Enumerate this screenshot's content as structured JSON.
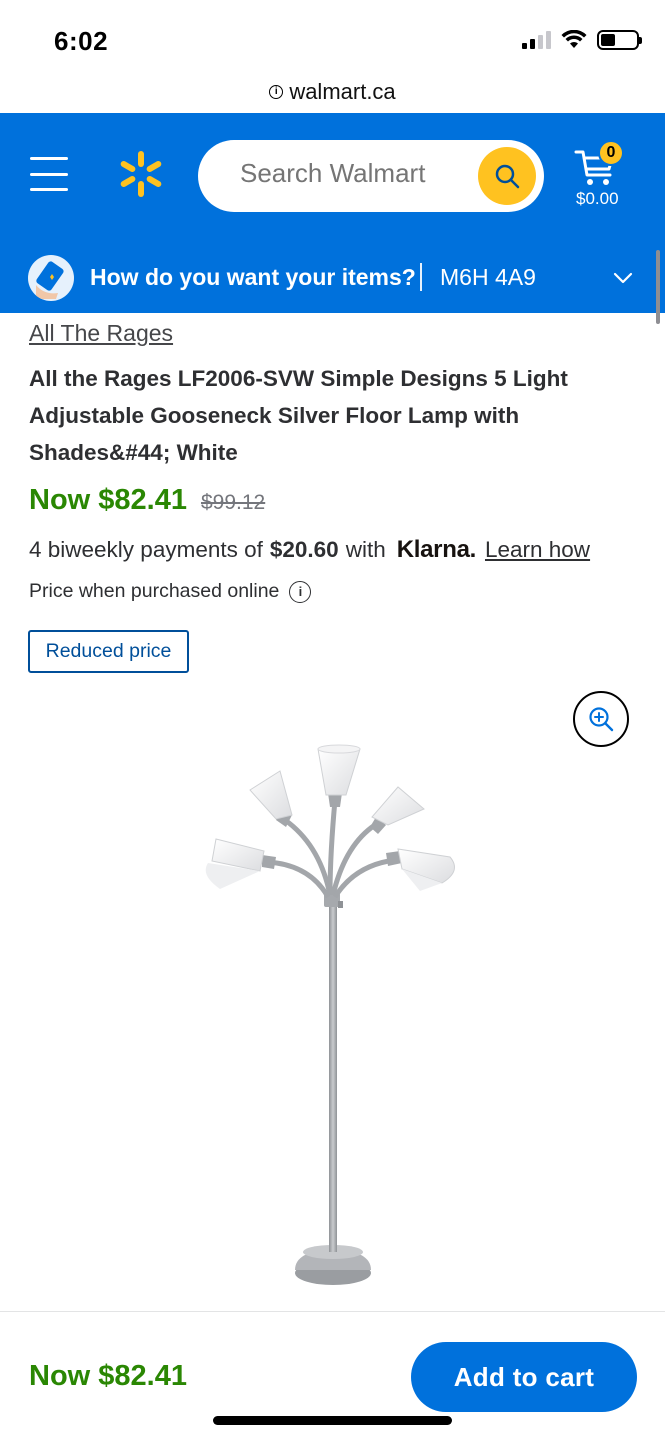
{
  "status_bar": {
    "time": "6:02",
    "icons": [
      "signal-icon",
      "wifi-icon",
      "battery-icon"
    ]
  },
  "browser": {
    "url": "walmart.ca",
    "url_icon": "info-icon"
  },
  "header": {
    "menu_icon": "hamburger-menu-icon",
    "logo_icon": "walmart-spark-icon",
    "search": {
      "placeholder": "Search Walmart",
      "button_icon": "search-icon"
    },
    "cart": {
      "count": "0",
      "total": "$0.00",
      "icon": "cart-icon"
    },
    "delivery": {
      "question": "How do you want your items?",
      "separator": "|",
      "postal_code": "M6H 4A9",
      "chevron_icon": "chevron-down-icon"
    }
  },
  "product": {
    "brand": "All The Rages",
    "title": "All the Rages LF2006-SVW Simple Designs 5 Light Adjustable Gooseneck Silver Floor Lamp with Shades&#44; White",
    "price_now": "Now $82.41",
    "price_was": "$99.12",
    "klarna": {
      "prefix": "4 biweekly payments of",
      "amount": "$20.60",
      "with": "with",
      "logo": "Klarna.",
      "learn_link": "Learn how"
    },
    "online_note": "Price when purchased online",
    "online_note_icon": "info-icon",
    "badge": "Reduced price",
    "zoom_icon": "zoom-in-icon",
    "image_alt": "floor-lamp-image"
  },
  "bottom_bar": {
    "price": "Now $82.41",
    "add_to_cart": "Add to cart"
  },
  "colors": {
    "brand_blue": "#0071dc",
    "spark_yellow": "#ffc220",
    "price_green": "#2a8703",
    "badge_blue": "#004f9a"
  }
}
